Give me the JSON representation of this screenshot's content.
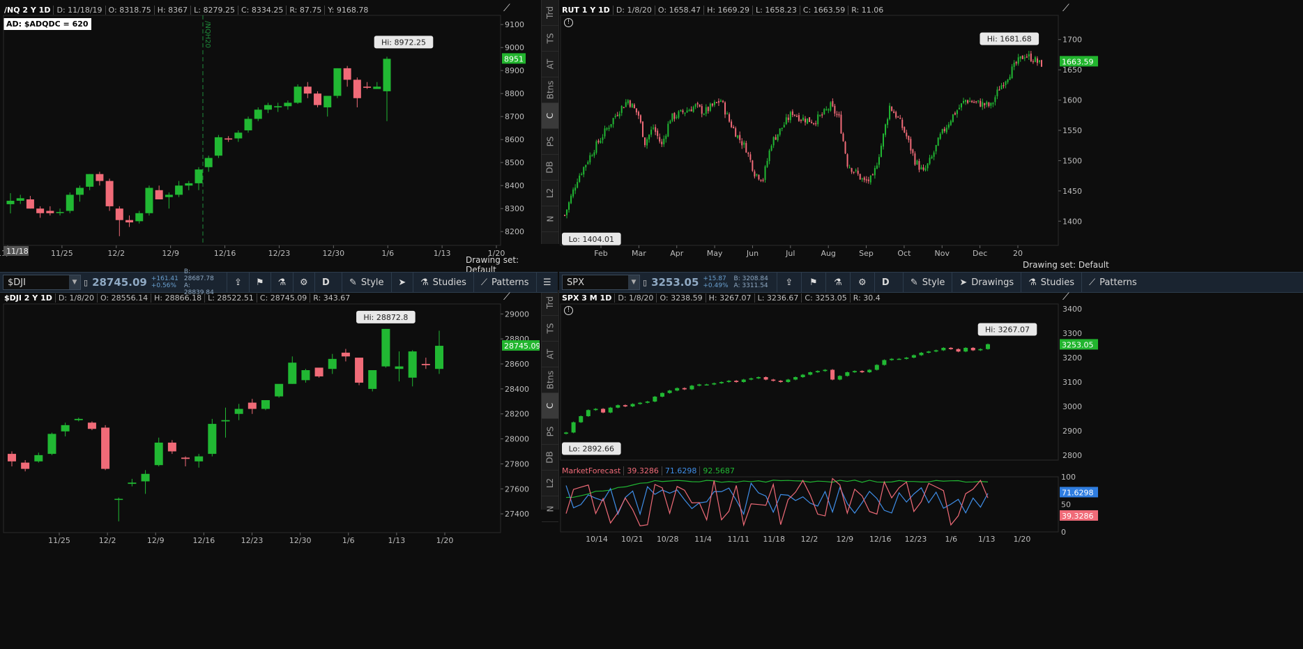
{
  "colors": {
    "up": "#21b833",
    "down": "#f06b78",
    "bg": "#0d0d0d",
    "grid": "#232323",
    "tooltipBg": "#e8e8e8",
    "lastUp": "#22b52e",
    "sep": "#444444"
  },
  "sidetabs": [
    "Trd",
    "TS",
    "AT",
    "Btns",
    "C",
    "PS",
    "DB",
    "L2",
    "N"
  ],
  "sidetabs_active": "C",
  "icons": {
    "drawing_toggle": "pencil-chart-icon",
    "alert": "info-circle-icon"
  },
  "tl": {
    "hdr": {
      "sym": "/NQ 2 Y 1D",
      "d": "D: 11/18/19",
      "o": "O: 8318.75",
      "h": "H: 8367",
      "l": "L: 8279.25",
      "c": "C: 8334.25",
      "r": "R: 87.75",
      "y": "Y: 9168.78"
    },
    "ad_label": "AD: $ADQDC = 620",
    "vline_label": "/NQH20",
    "hi_label": "Hi: 8972.25",
    "last_label": "8951",
    "bottom": {
      "drawing_set": "Drawing set: Default"
    },
    "chart_data": {
      "type": "candlestick",
      "title": "/NQ 2 Y 1D",
      "ylim": [
        8140,
        9140
      ],
      "yticks": [
        8200,
        8300,
        8400,
        8500,
        8600,
        8700,
        8800,
        8900,
        9000,
        9100
      ],
      "xlabels": [
        "11/18",
        "11/25",
        "12/2",
        "12/9",
        "12/16",
        "12/23",
        "12/30",
        "1/6",
        "1/13",
        "1/20"
      ],
      "candles": [
        [
          8319,
          8367,
          8279,
          8334
        ],
        [
          8334,
          8360,
          8320,
          8345
        ],
        [
          8340,
          8355,
          8300,
          8300
        ],
        [
          8300,
          8310,
          8260,
          8280
        ],
        [
          8290,
          8310,
          8270,
          8280
        ],
        [
          8285,
          8300,
          8270,
          8285
        ],
        [
          8290,
          8370,
          8280,
          8360
        ],
        [
          8360,
          8400,
          8330,
          8390
        ],
        [
          8395,
          8450,
          8380,
          8450
        ],
        [
          8450,
          8460,
          8400,
          8420
        ],
        [
          8420,
          8430,
          8290,
          8310
        ],
        [
          8300,
          8310,
          8180,
          8250
        ],
        [
          8250,
          8270,
          8220,
          8240
        ],
        [
          8245,
          8290,
          8235,
          8280
        ],
        [
          8280,
          8400,
          8270,
          8390
        ],
        [
          8380,
          8400,
          8340,
          8340
        ],
        [
          8350,
          8370,
          8300,
          8360
        ],
        [
          8360,
          8420,
          8350,
          8400
        ],
        [
          8400,
          8420,
          8380,
          8410
        ],
        [
          8410,
          8480,
          8380,
          8470
        ],
        [
          8480,
          8530,
          8460,
          8520
        ],
        [
          8530,
          8620,
          8520,
          8610
        ],
        [
          8605,
          8615,
          8590,
          8600
        ],
        [
          8605,
          8640,
          8590,
          8630
        ],
        [
          8640,
          8700,
          8630,
          8690
        ],
        [
          8690,
          8740,
          8680,
          8730
        ],
        [
          8730,
          8760,
          8715,
          8750
        ],
        [
          8740,
          8760,
          8720,
          8745
        ],
        [
          8745,
          8770,
          8730,
          8760
        ],
        [
          8760,
          8840,
          8755,
          8830
        ],
        [
          8830,
          8850,
          8780,
          8800
        ],
        [
          8800,
          8810,
          8740,
          8750
        ],
        [
          8740,
          8790,
          8700,
          8790
        ],
        [
          8790,
          8910,
          8780,
          8910
        ],
        [
          8910,
          8920,
          8830,
          8860
        ],
        [
          8860,
          8870,
          8740,
          8780
        ],
        [
          8830,
          8850,
          8820,
          8825
        ],
        [
          8820,
          8850,
          8820,
          8830
        ],
        [
          8810,
          8960,
          8680,
          8951
        ]
      ]
    }
  },
  "tr": {
    "hdr": {
      "sym": "RUT 1 Y 1D",
      "d": "D: 1/8/20",
      "o": "O: 1658.47",
      "h": "H: 1669.29",
      "l": "L: 1658.23",
      "c": "C: 1663.59",
      "r": "R: 11.06"
    },
    "hi_label": "Hi: 1681.68",
    "lo_label": "Lo: 1404.01",
    "last_label": "1663.59",
    "bottom": {
      "drawing_set": "Drawing set: Default"
    },
    "chart_data": {
      "type": "candlestick",
      "title": "RUT 1 Y 1D",
      "ylim": [
        1360,
        1740
      ],
      "yticks": [
        1400,
        1450,
        1500,
        1550,
        1600,
        1650,
        1700
      ],
      "xlabels": [
        "Feb",
        "Mar",
        "Apr",
        "May",
        "Jun",
        "Jul",
        "Aug",
        "Sep",
        "Oct",
        "Nov",
        "Dec",
        "20"
      ],
      "trend": [
        [
          0,
          1410
        ],
        [
          6,
          1470
        ],
        [
          14,
          1520
        ],
        [
          25,
          1580
        ],
        [
          30,
          1600
        ],
        [
          35,
          1575
        ],
        [
          38,
          1530
        ],
        [
          42,
          1555
        ],
        [
          46,
          1525
        ],
        [
          50,
          1570
        ],
        [
          56,
          1580
        ],
        [
          62,
          1590
        ],
        [
          66,
          1580
        ],
        [
          70,
          1590
        ],
        [
          74,
          1600
        ],
        [
          78,
          1565
        ],
        [
          82,
          1540
        ],
        [
          86,
          1520
        ],
        [
          90,
          1480
        ],
        [
          94,
          1470
        ],
        [
          98,
          1530
        ],
        [
          102,
          1550
        ],
        [
          108,
          1580
        ],
        [
          112,
          1570
        ],
        [
          118,
          1565
        ],
        [
          122,
          1575
        ],
        [
          126,
          1590
        ],
        [
          130,
          1570
        ],
        [
          134,
          1495
        ],
        [
          138,
          1480
        ],
        [
          142,
          1465
        ],
        [
          146,
          1470
        ],
        [
          150,
          1525
        ],
        [
          154,
          1590
        ],
        [
          158,
          1570
        ],
        [
          162,
          1540
        ],
        [
          166,
          1500
        ],
        [
          170,
          1480
        ],
        [
          174,
          1505
        ],
        [
          178,
          1540
        ],
        [
          184,
          1575
        ],
        [
          190,
          1600
        ],
        [
          196,
          1595
        ],
        [
          202,
          1590
        ],
        [
          206,
          1620
        ],
        [
          210,
          1640
        ],
        [
          214,
          1660
        ],
        [
          218,
          1675
        ],
        [
          222,
          1668
        ],
        [
          225,
          1660
        ]
      ]
    }
  },
  "bl_toolbar": {
    "symbol": "$DJI",
    "price": "28745.09",
    "chg1": "+161.41",
    "chg2": "+0.56%",
    "bid": "B: 28687.78",
    "ask": "A: 28839.84",
    "period": "D",
    "style": "Style",
    "studies": "Studies",
    "patterns": "Patterns",
    "icons": [
      "share-icon",
      "flag-icon",
      "flask-icon",
      "gear-icon",
      "cursor-icon",
      "menu-icon"
    ]
  },
  "bl": {
    "hdr": {
      "sym": "$DJI 2 Y 1D",
      "d": "D: 1/8/20",
      "o": "O: 28556.14",
      "h": "H: 28866.18",
      "l": "L: 28522.51",
      "c": "C: 28745.09",
      "r": "R: 343.67"
    },
    "hi_label": "Hi: 28872.8",
    "last_label": "28745.09",
    "chart_data": {
      "type": "candlestick",
      "title": "$DJI 2 Y 1D",
      "ylim": [
        27250,
        29080
      ],
      "yticks": [
        27400,
        27600,
        27800,
        28000,
        28200,
        28400,
        28600,
        28800,
        29000
      ],
      "xlabels": [
        "11/25",
        "12/2",
        "12/9",
        "12/16",
        "12/23",
        "12/30",
        "1/6",
        "1/13",
        "1/20"
      ],
      "candles": [
        [
          27880,
          27900,
          27780,
          27820
        ],
        [
          27810,
          27830,
          27740,
          27760
        ],
        [
          27820,
          27890,
          27810,
          27870
        ],
        [
          27880,
          28050,
          27870,
          28040
        ],
        [
          28060,
          28130,
          28020,
          28110
        ],
        [
          28150,
          28170,
          28140,
          28160
        ],
        [
          28130,
          28140,
          28070,
          28080
        ],
        [
          28090,
          28110,
          27750,
          27760
        ],
        [
          27520,
          27530,
          27340,
          27520
        ],
        [
          27640,
          27680,
          27620,
          27650
        ],
        [
          27660,
          27750,
          27560,
          27720
        ],
        [
          27790,
          28010,
          27780,
          27970
        ],
        [
          27970,
          27990,
          27880,
          27900
        ],
        [
          27850,
          27860,
          27780,
          27840
        ],
        [
          27820,
          27880,
          27770,
          27860
        ],
        [
          27880,
          28160,
          27860,
          28120
        ],
        [
          28140,
          28250,
          28010,
          28150
        ],
        [
          28200,
          28280,
          28150,
          28240
        ],
        [
          28290,
          28320,
          28200,
          28240
        ],
        [
          28240,
          28310,
          28230,
          28310
        ],
        [
          28340,
          28400,
          28330,
          28440
        ],
        [
          28440,
          28660,
          28440,
          28610
        ],
        [
          28470,
          28560,
          28450,
          28550
        ],
        [
          28570,
          28540,
          28490,
          28500
        ],
        [
          28560,
          28680,
          28520,
          28640
        ],
        [
          28690,
          28720,
          28620,
          28660
        ],
        [
          28650,
          28620,
          28430,
          28450
        ],
        [
          28400,
          28550,
          28380,
          28550
        ],
        [
          28580,
          28880,
          28570,
          28880
        ],
        [
          28560,
          28700,
          28460,
          28580
        ],
        [
          28490,
          28710,
          28420,
          28700
        ],
        [
          28600,
          28650,
          28560,
          28590
        ],
        [
          28560,
          28866,
          28520,
          28745
        ]
      ]
    }
  },
  "br_toolbar": {
    "symbol": "SPX",
    "price": "3253.05",
    "chg1": "+15.87",
    "chg2": "+0.49%",
    "bid": "B: 3208.84",
    "ask": "A: 3311.54",
    "period": "D",
    "style": "Style",
    "drawings": "Drawings",
    "studies": "Studies",
    "patterns": "Patterns",
    "icons": [
      "share-icon",
      "flag-icon",
      "flask-icon",
      "gear-icon",
      "cursor-icon"
    ]
  },
  "br": {
    "hdr": {
      "sym": "SPX 3 M 1D",
      "d": "D: 1/8/20",
      "o": "O: 3238.59",
      "h": "H: 3267.07",
      "l": "L: 3236.67",
      "c": "C: 3253.05",
      "r": "R: 30.4"
    },
    "hi_label": "Hi: 3267.07",
    "lo_label": "Lo: 2892.66",
    "last_label": "3253.05",
    "chart_data": {
      "type": "candlestick",
      "title": "SPX 3 M 1D",
      "ylim": [
        2780,
        3420
      ],
      "yticks": [
        2800,
        2900,
        3000,
        3100,
        3200,
        3300,
        3400
      ],
      "xlabels": [
        "10/14",
        "10/21",
        "10/28",
        "11/4",
        "11/11",
        "11/18",
        "12/2",
        "12/9",
        "12/16",
        "12/23",
        "1/6",
        "1/13",
        "1/20"
      ],
      "closes": [
        2893,
        2935,
        2960,
        2985,
        2990,
        2975,
        2995,
        3005,
        3000,
        3010,
        3015,
        3020,
        3040,
        3055,
        3065,
        3075,
        3070,
        3085,
        3090,
        3090,
        3095,
        3100,
        3105,
        3100,
        3110,
        3115,
        3120,
        3110,
        3105,
        3100,
        3110,
        3120,
        3130,
        3140,
        3145,
        3150,
        3110,
        3125,
        3140,
        3145,
        3140,
        3150,
        3170,
        3190,
        3195,
        3195,
        3200,
        3210,
        3220,
        3225,
        3230,
        3240,
        3235,
        3225,
        3240,
        3230,
        3235,
        3255
      ]
    },
    "mf": {
      "name": "MarketForecast",
      "v1": "39.3286",
      "v2": "71.6298",
      "v3": "92.5687",
      "label_blue": "71.6298",
      "label_red": "39.3286",
      "yticks": [
        "100",
        "50",
        "0"
      ]
    }
  }
}
